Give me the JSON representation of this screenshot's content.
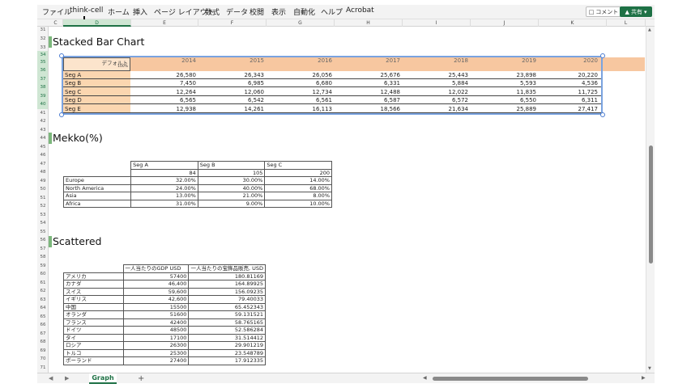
{
  "ribbon": {
    "tabs": [
      "ファイル",
      "think-cell",
      "ホーム",
      "挿入",
      "ページ レイアウト",
      "数式",
      "データ",
      "校閲",
      "表示",
      "自動化",
      "ヘルプ",
      "Acrobat"
    ],
    "comment_label": "コメント",
    "share_label": "共有"
  },
  "columns": [
    "C",
    "D",
    "E",
    "F",
    "G",
    "H",
    "I",
    "J",
    "K",
    "L"
  ],
  "rows": [
    "31",
    "32",
    "33",
    "34",
    "35",
    "36",
    "37",
    "38",
    "39",
    "40",
    "41",
    "42",
    "43",
    "44",
    "45",
    "46",
    "47",
    "48",
    "49",
    "50",
    "51",
    "52",
    "53",
    "54",
    "55",
    "56",
    "57",
    "58",
    "59",
    "60",
    "61",
    "62",
    "63",
    "64",
    "65",
    "66",
    "67",
    "68",
    "69",
    "70",
    "71"
  ],
  "stacked": {
    "title": "Stacked Bar Chart",
    "corner_label": "デフォルト",
    "corner_sub": "100%",
    "years": [
      "2014",
      "2015",
      "2016",
      "2017",
      "2018",
      "2019",
      "2020"
    ],
    "series": [
      {
        "name": "Seg A",
        "values": [
          "26,580",
          "26,343",
          "26,056",
          "25,676",
          "25,443",
          "23,898",
          "20,220"
        ]
      },
      {
        "name": "Seg B",
        "values": [
          "7,450",
          "6,985",
          "6,680",
          "6,331",
          "5,884",
          "5,593",
          "4,536"
        ]
      },
      {
        "name": "Seg C",
        "values": [
          "12,264",
          "12,060",
          "12,734",
          "12,488",
          "12,022",
          "11,835",
          "11,725"
        ]
      },
      {
        "name": "Seg D",
        "values": [
          "6,565",
          "6,542",
          "6,561",
          "6,587",
          "6,572",
          "6,550",
          "6,311"
        ]
      },
      {
        "name": "Seg E",
        "values": [
          "12,938",
          "14,261",
          "16,113",
          "18,566",
          "21,634",
          "25,889",
          "27,417"
        ]
      }
    ]
  },
  "mekko": {
    "title": "Mekko(%)",
    "headers": [
      "Seg A",
      "Seg B",
      "Seg C"
    ],
    "widths": [
      "84",
      "105",
      "200"
    ],
    "rows": [
      {
        "name": "Europe",
        "values": [
          "32.00%",
          "30.00%",
          "14.00%"
        ]
      },
      {
        "name": "North America",
        "values": [
          "24.00%",
          "40.00%",
          "68.00%"
        ]
      },
      {
        "name": "Asia",
        "values": [
          "13.00%",
          "21.00%",
          "8.00%"
        ]
      },
      {
        "name": "Africa",
        "values": [
          "31.00%",
          "9.00%",
          "10.00%"
        ]
      }
    ]
  },
  "scatter": {
    "title": "Scattered",
    "headers": [
      "一人当たりのGDP USD",
      "一人当たりの宝飾品販売, USD"
    ],
    "rows": [
      {
        "name": "アメリカ",
        "gdp": "57400",
        "jewel": "180.81169"
      },
      {
        "name": "カナダ",
        "gdp": "46,400",
        "jewel": "164.89925"
      },
      {
        "name": "スイス",
        "gdp": "59,600",
        "jewel": "156.09235"
      },
      {
        "name": "イギリス",
        "gdp": "42,600",
        "jewel": "79.40033"
      },
      {
        "name": "中国",
        "gdp": "15500",
        "jewel": "65.452343"
      },
      {
        "name": "オランダ",
        "gdp": "51600",
        "jewel": "59.131521"
      },
      {
        "name": "フランス",
        "gdp": "42400",
        "jewel": "58.765165"
      },
      {
        "name": "ドイツ",
        "gdp": "48500",
        "jewel": "52.586284"
      },
      {
        "name": "タイ",
        "gdp": "17100",
        "jewel": "31.514412"
      },
      {
        "name": "ロシア",
        "gdp": "26300",
        "jewel": "29.901219"
      },
      {
        "name": "トルコ",
        "gdp": "25300",
        "jewel": "23.548789"
      },
      {
        "name": "ポーランド",
        "gdp": "27400",
        "jewel": "17.912335"
      }
    ]
  },
  "sheet": {
    "tab_label": "Graph",
    "add_label": "+"
  }
}
